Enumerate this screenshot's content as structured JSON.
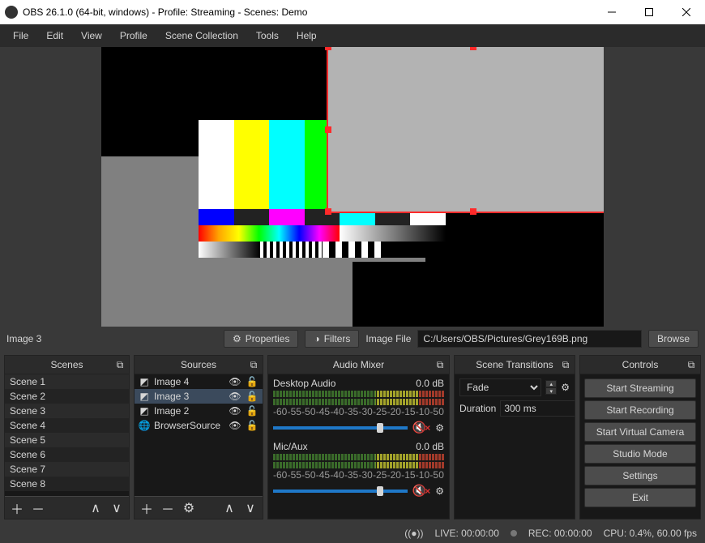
{
  "window": {
    "title": "OBS 26.1.0 (64-bit, windows) - Profile: Streaming - Scenes: Demo"
  },
  "menu": {
    "file": "File",
    "edit": "Edit",
    "view": "View",
    "profile": "Profile",
    "scene_collection": "Scene Collection",
    "tools": "Tools",
    "help": "Help"
  },
  "context": {
    "selected_source": "Image 3",
    "properties": "Properties",
    "filters": "Filters",
    "field_label": "Image File",
    "field_value": "C:/Users/OBS/Pictures/Grey169B.png",
    "browse": "Browse"
  },
  "panels": {
    "scenes": {
      "title": "Scenes",
      "items": [
        "Scene 1",
        "Scene 2",
        "Scene 3",
        "Scene 4",
        "Scene 5",
        "Scene 6",
        "Scene 7",
        "Scene 8"
      ]
    },
    "sources": {
      "title": "Sources",
      "items": [
        {
          "label": "Image 4",
          "type": "image",
          "visible": true,
          "locked": false
        },
        {
          "label": "Image 3",
          "type": "image",
          "visible": true,
          "locked": false,
          "selected": true
        },
        {
          "label": "Image 2",
          "type": "image",
          "visible": true,
          "locked": false
        },
        {
          "label": "BrowserSource",
          "type": "browser",
          "visible": true,
          "locked": false
        }
      ]
    },
    "mixer": {
      "title": "Audio Mixer",
      "channels": [
        {
          "name": "Desktop Audio",
          "level": "0.0 dB"
        },
        {
          "name": "Mic/Aux",
          "level": "0.0 dB"
        }
      ],
      "scale": [
        "-60",
        "-55",
        "-50",
        "-45",
        "-40",
        "-35",
        "-30",
        "-25",
        "-20",
        "-15",
        "-10",
        "-5",
        "0"
      ]
    },
    "transitions": {
      "title": "Scene Transitions",
      "selected": "Fade",
      "duration_label": "Duration",
      "duration": "300 ms"
    },
    "controls": {
      "title": "Controls",
      "buttons": [
        "Start Streaming",
        "Start Recording",
        "Start Virtual Camera",
        "Studio Mode",
        "Settings",
        "Exit"
      ]
    }
  },
  "status": {
    "live": "LIVE: 00:00:00",
    "rec": "REC: 00:00:00",
    "cpu": "CPU: 0.4%, 60.00 fps"
  }
}
